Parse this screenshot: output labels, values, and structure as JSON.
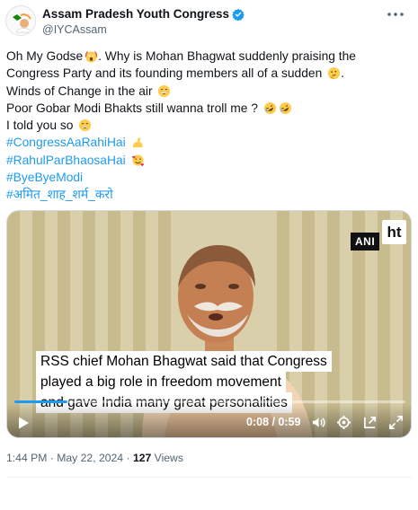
{
  "author": {
    "name": "Assam Pradesh Youth Congress",
    "handle": "@IYCAssam",
    "verified_color": "#1d9bf0"
  },
  "tweet": {
    "line1": "Oh My Godse",
    "line1b": ". Why is Mohan Bhagwat suddenly praising the",
    "line2": "Congress Party and its founding members all of a sudden",
    "line2b": ".",
    "line3": "Winds of Change in the air",
    "line4": "Poor Gobar Modi Bhakts still wanna troll me ?",
    "line5": " I told you so",
    "hashtags": [
      "#CongressAaRahiHai",
      "#RahulParBhaosaHai",
      "#ByeByeModi",
      "#अमित_शाह_शर्म_करो"
    ],
    "hashtag_color": "#1d9bf0"
  },
  "video": {
    "ani_label": "ANI",
    "ht_label": "ht",
    "caption_line1": "RSS chief Mohan Bhagwat said that Congress",
    "caption_line2": "played a big role in freedom movement",
    "caption_line3": "and gave India many great personalities",
    "time": "0:08 / 0:59",
    "progress_fraction": 0.136
  },
  "meta": {
    "time": "1:44 PM",
    "separator": " · ",
    "date": "May 22, 2024",
    "views_count": "127",
    "views_label": " Views"
  }
}
